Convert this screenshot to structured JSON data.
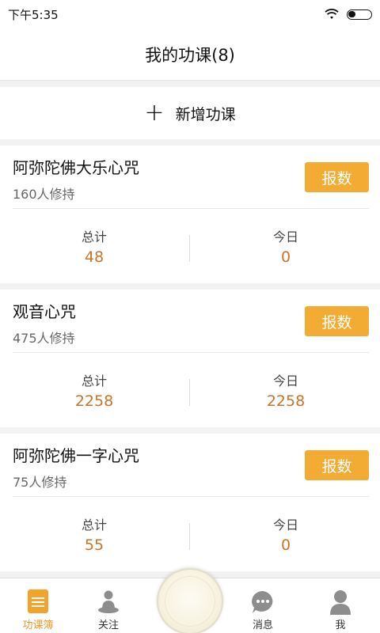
{
  "status_bar": {
    "time": "下午5:35",
    "battery_level": 0.35
  },
  "header": {
    "title": "我的功课(8)"
  },
  "add_bar": {
    "label": "新增功课"
  },
  "cards": [
    {
      "name": "阿弥陀佛大乐心咒",
      "practitioners": "160人修持",
      "button": "报数",
      "total_label": "总计",
      "total": "48",
      "today_label": "今日",
      "today": "0"
    },
    {
      "name": "观音心咒",
      "practitioners": "475人修持",
      "button": "报数",
      "total_label": "总计",
      "total": "2258",
      "today_label": "今日",
      "today": "2258"
    },
    {
      "name": "阿弥陀佛一字心咒",
      "practitioners": "75人修持",
      "button": "报数",
      "total_label": "总计",
      "total": "55",
      "today_label": "今日",
      "today": "0"
    }
  ],
  "tab_bar": {
    "tabs": [
      {
        "label": "功课簿",
        "icon": "book-icon",
        "active": true
      },
      {
        "label": "关注",
        "icon": "meditation-icon",
        "active": false
      },
      {
        "label": "消息",
        "icon": "chat-icon",
        "active": false
      },
      {
        "label": "我",
        "icon": "user-icon",
        "active": false
      }
    ]
  },
  "colors": {
    "accent": "#f2ac33",
    "value": "#c8752a",
    "active_tab": "#e89a2a"
  }
}
